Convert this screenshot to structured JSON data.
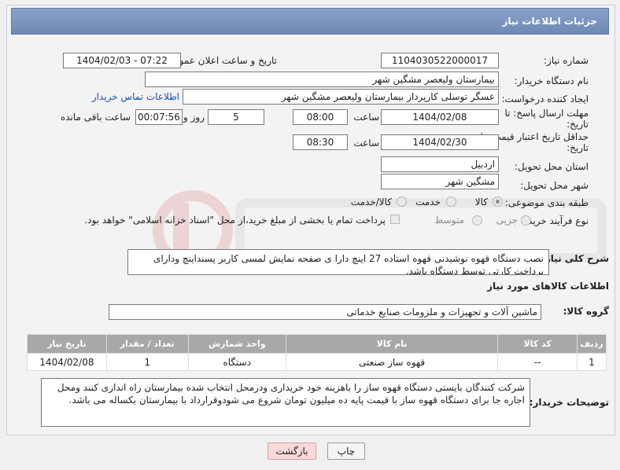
{
  "header_title": "جزئیات اطلاعات نیاز",
  "fields": {
    "need_number_label": "شماره نیاز:",
    "need_number": "1104030522000017",
    "announce_label": "تاریخ و ساعت اعلان عمومی:",
    "announce_value": "1404/02/03 - 07:22",
    "buyer_label": "نام دستگاه خریدار:",
    "buyer_value": "بیمارستان ولیعصر مشگین شهر",
    "creator_label": "ایجاد کننده درخواست:",
    "creator_value": "عسگر توسلی کارپرداز بیمارستان ولیعصر مشگین شهر",
    "contact_link": "اطلاعات تماس خریدار",
    "deadline_label": "مهلت ارسال پاسخ: تا تاریخ:",
    "deadline_date": "1404/02/08",
    "time_label": "ساعت",
    "deadline_time": "08:00",
    "days_value": "5",
    "days_label": "روز و",
    "remaining_value": "00:07:56",
    "remaining_label": "ساعت باقی مانده",
    "validity_label": "حداقل تاریخ اعتبار قیمت: تا تاریخ:",
    "validity_date": "1404/02/30",
    "validity_time": "08:30",
    "province_label": "استان محل تحویل:",
    "province_value": "اردبیل",
    "city_label": "شهر محل تحویل:",
    "city_value": "مشگین شهر",
    "category_label": "طبقه بندی موضوعی:",
    "category_options": [
      "کالا",
      "خدمت",
      "کالا/خدمت"
    ],
    "process_label": "نوع فرآیند خرید :",
    "process_options": [
      "جزیی",
      "متوسط"
    ],
    "payment_note": "پرداخت تمام یا بخشی از مبلغ خرید،از محل \"اسناد خزانه اسلامی\" خواهد بود.",
    "desc_label": "شرح کلی نیاز:",
    "desc_value": "نصب دستگاه قهوه نوشیدنی قهوه استاده 27 اینچ دارا ی صفحه نمایش لمسی کاربر پسنداینچ ودارای پرداخت کارتی توسط دستگاه باشد.",
    "goods_info_title": "اطلاعات کالاهای مورد نیاز",
    "group_label": "گروه کالا:",
    "group_value": "ماشین آلات و تجهیزات و ملزومات صنایع خدماتی",
    "notes_label": "توضیحات خریدار:",
    "notes_value": "شرکت کنندگان بایستی دستگاه قهوه ساز را باهزینه خود خریداری ودرمحل انتخاب شده بیمارستان راه اندازی کنند ومحل اجاره جا برای دستگاه قهوه ساز با قیمت پایه ده میلیون تومان شروع می شودوقرارداد با بیمارستان یکساله می باشد."
  },
  "table": {
    "headers": [
      "ردیف",
      "کد کالا",
      "نام کالا",
      "واحد شمارش",
      "تعداد / مقدار",
      "تاریخ نیاز"
    ],
    "rows": [
      [
        "1",
        "--",
        "قهوه ساز صنعتی",
        "دستگاه",
        "1",
        "1404/02/08"
      ]
    ]
  },
  "buttons": {
    "print": "چاپ",
    "back": "بازگشت"
  },
  "colors": {
    "header_bg": "#7a93bd",
    "table_header_bg": "#a8a8a8",
    "back_button_bg": "#f9d9d9",
    "link": "#1a4fb3"
  }
}
